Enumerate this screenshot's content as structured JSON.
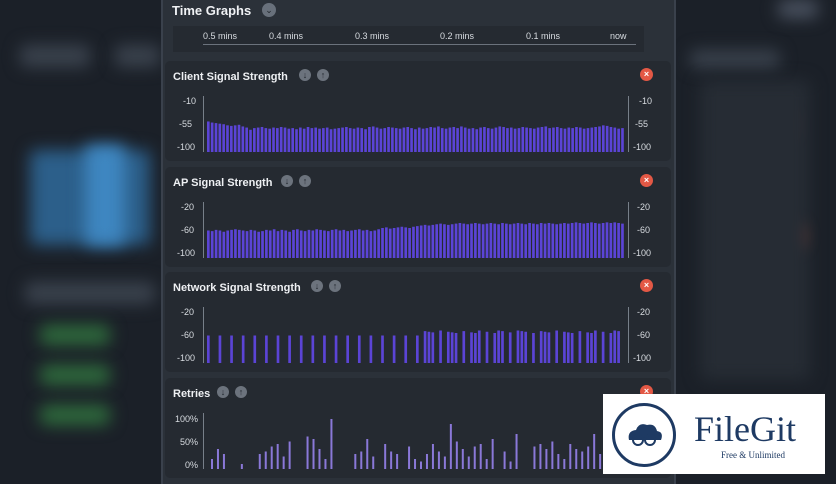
{
  "panel": {
    "title": "Time Graphs",
    "time_axis": [
      "0.5 mins",
      "0.4 mins",
      "0.3 mins",
      "0.2 mins",
      "0.1 mins",
      "now"
    ]
  },
  "cards": [
    {
      "title": "Client Signal Strength",
      "y_left": [
        "-10",
        "-55",
        "-100"
      ],
      "y_right": [
        "-10",
        "-55",
        "-100"
      ]
    },
    {
      "title": "AP Signal Strength",
      "y_left": [
        "-20",
        "-60",
        "-100"
      ],
      "y_right": [
        "-20",
        "-60",
        "-100"
      ]
    },
    {
      "title": "Network Signal Strength",
      "y_left": [
        "-20",
        "-60",
        "-100"
      ],
      "y_right": [
        "-20",
        "-60",
        "-100"
      ]
    },
    {
      "title": "Retries",
      "y_left": [
        "100%",
        "50%",
        "0%"
      ],
      "y_right": []
    }
  ],
  "icons": {
    "chevron": "chevron-down-icon",
    "down": "arrow-down-icon",
    "up": "arrow-up-icon",
    "close": "close-icon"
  },
  "colors": {
    "bar": "#5b44d6",
    "retries_bar": "#8a78d8",
    "close": "#e35845"
  },
  "watermark": {
    "name": "FileGit",
    "tagline": "Free & Unlimited"
  },
  "series": {
    "client": [
      -45,
      -47,
      -48,
      -49,
      -50,
      -52,
      -53,
      -52,
      -51,
      -54,
      -56,
      -60,
      -57,
      -56,
      -55,
      -57,
      -58,
      -56,
      -57,
      -55,
      -56,
      -58,
      -57,
      -59,
      -56,
      -58,
      -55,
      -57,
      -56,
      -58,
      -57,
      -56,
      -59,
      -58,
      -57,
      -56,
      -55,
      -57,
      -58,
      -56,
      -57,
      -59,
      -55,
      -54,
      -56,
      -58,
      -57,
      -55,
      -56,
      -57,
      -58,
      -56,
      -55,
      -57,
      -59,
      -56,
      -58,
      -57,
      -55,
      -56,
      -54,
      -57,
      -58,
      -56,
      -55,
      -57,
      -54,
      -56,
      -58,
      -57,
      -59,
      -56,
      -55,
      -57,
      -58,
      -56,
      -54,
      -55,
      -57,
      -56,
      -58,
      -57,
      -55,
      -56,
      -57,
      -58,
      -56,
      -55,
      -54,
      -57,
      -56,
      -55,
      -57,
      -58,
      -56,
      -57,
      -55,
      -56,
      -58,
      -57,
      -56,
      -55,
      -54,
      -52,
      -53,
      -55,
      -56,
      -58,
      -57
    ],
    "ap": [
      -56,
      -57,
      -55,
      -56,
      -58,
      -56,
      -55,
      -54,
      -55,
      -56,
      -57,
      -55,
      -56,
      -58,
      -57,
      -55,
      -56,
      -54,
      -57,
      -55,
      -56,
      -58,
      -55,
      -54,
      -56,
      -57,
      -55,
      -56,
      -54,
      -55,
      -56,
      -57,
      -55,
      -54,
      -56,
      -55,
      -57,
      -56,
      -55,
      -54,
      -56,
      -55,
      -57,
      -56,
      -54,
      -52,
      -51,
      -53,
      -52,
      -51,
      -50,
      -51,
      -52,
      -50,
      -49,
      -48,
      -47,
      -48,
      -47,
      -46,
      -45,
      -46,
      -47,
      -46,
      -45,
      -44,
      -45,
      -46,
      -45,
      -44,
      -45,
      -46,
      -45,
      -44,
      -45,
      -46,
      -44,
      -45,
      -46,
      -45,
      -44,
      -45,
      -46,
      -44,
      -45,
      -46,
      -44,
      -45,
      -44,
      -45,
      -46,
      -45,
      -44,
      -45,
      -44,
      -43,
      -44,
      -45,
      -44,
      -43,
      -44,
      -45,
      -44,
      -43,
      -44,
      -43,
      -44,
      -45
    ]
  }
}
